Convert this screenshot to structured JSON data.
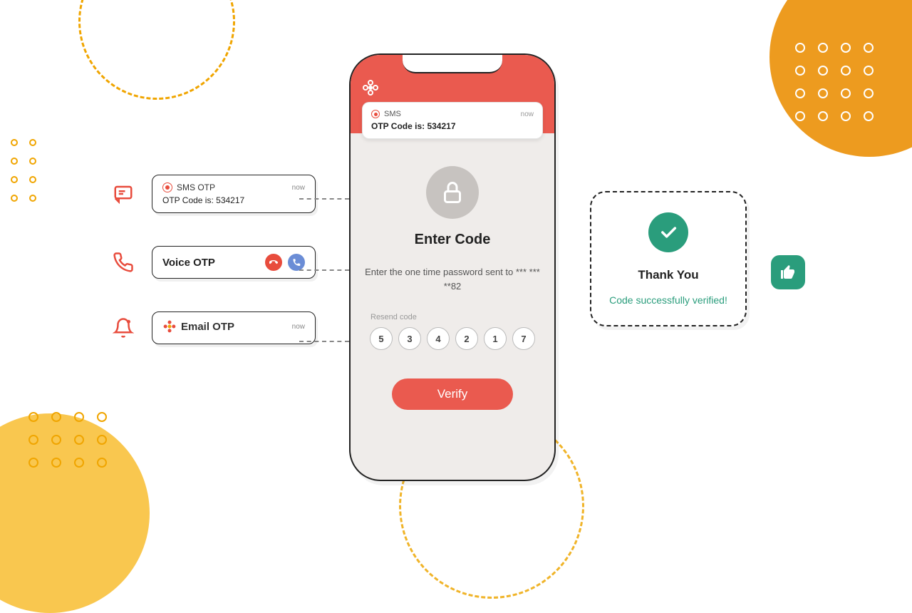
{
  "otp_channels": {
    "sms": {
      "title": "SMS OTP",
      "timestamp": "now",
      "body": "OTP Code is: 534217"
    },
    "voice": {
      "title": "Voice OTP"
    },
    "email": {
      "title": "Email OTP",
      "timestamp": "now"
    }
  },
  "phone": {
    "notification": {
      "app": "SMS",
      "timestamp": "now",
      "body": "OTP Code is: 534217"
    },
    "heading": "Enter Code",
    "subtext": "Enter the one time password sent to *** *** **82",
    "resend_label": "Resend code",
    "code_digits": [
      "5",
      "3",
      "4",
      "2",
      "1",
      "7"
    ],
    "verify_label": "Verify"
  },
  "success": {
    "title": "Thank You",
    "message": "Code successfully verified!"
  }
}
